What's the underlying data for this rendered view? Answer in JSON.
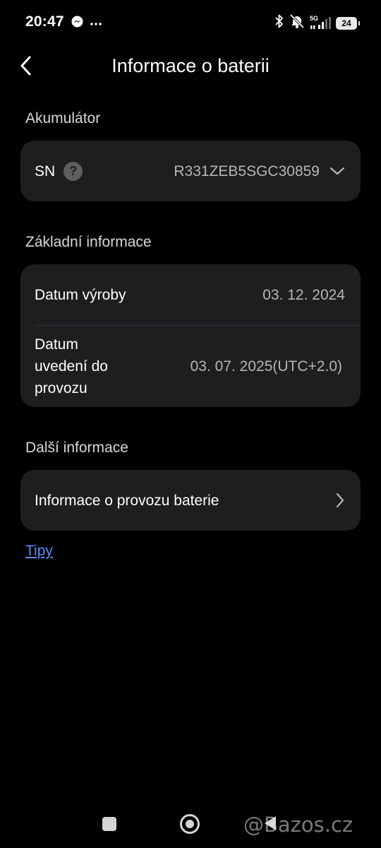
{
  "status_bar": {
    "time": "20:47",
    "messenger_icon": "messenger-icon",
    "more_icon": "more-dots-icon",
    "network_label": "5G",
    "battery_level": "24"
  },
  "header": {
    "back_icon": "chevron-left-icon",
    "title": "Informace o baterii"
  },
  "sections": {
    "accumulator": {
      "label": "Akumulátor",
      "sn_label": "SN",
      "sn_help_icon": "?",
      "sn_value": "R331ZEB5SGC30859"
    },
    "basic_info": {
      "label": "Základní informace",
      "rows": [
        {
          "label": "Datum výroby",
          "value": "03. 12. 2024"
        },
        {
          "label": "Datum\nuvedení do\nprovozu",
          "value": "03. 07. 2025(UTC+2.0)"
        }
      ]
    },
    "more_info": {
      "label": "Další informace",
      "item_label": "Informace o provozu baterie"
    }
  },
  "tips_link": "Tipy",
  "watermark": "@Bazos.cz",
  "colors": {
    "background": "#000000",
    "card": "#1e1e21",
    "link": "#5b8cff",
    "secondary_text": "#b6b6b8"
  }
}
